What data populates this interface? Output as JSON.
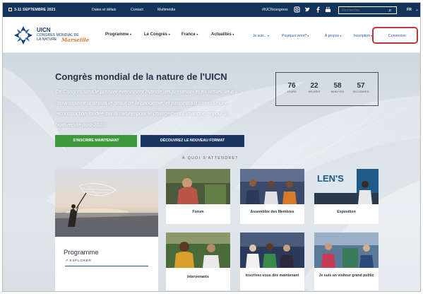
{
  "topbar": {
    "date": "3-11 SEPTEMBRE 2021",
    "links": [
      "Dates et délais",
      "Contact",
      "Multimédia"
    ],
    "hashtag": "#IUCNcongress",
    "social_icons": [
      "instagram-icon",
      "twitter-icon",
      "facebook-icon",
      "youtube-icon"
    ],
    "search_placeholder": "Recherche",
    "search_icon": "⌕",
    "language": "FR",
    "chevron": "⌄"
  },
  "logo": {
    "line1": "UICN",
    "line2": "CONGRÈS MONDIAL DE LA NATURE",
    "line3": "Marseille"
  },
  "nav": {
    "main": [
      {
        "label": "Programme",
        "caret": "▾"
      },
      {
        "label": "Le Congrès",
        "caret": "▾"
      },
      {
        "label": "France",
        "caret": "▾"
      },
      {
        "label": "Actualités",
        "caret": "▾"
      }
    ],
    "secondary": [
      {
        "label": "Je suis...",
        "caret": "▾"
      },
      {
        "label": "Pourquoi venir?",
        "caret": "▾"
      },
      {
        "label": "À propos",
        "caret": "▾"
      },
      {
        "label": "Inscription",
        "caret": "▾"
      }
    ],
    "connexion": "Connexion"
  },
  "hero": {
    "title": "Congrès mondial de la nature de l'UICN",
    "description": "Ce Congrès sera le premier événement hybride, en présentiel et en virtuel, lié à l'environnement depuis le début de la pandémie, et permettra d'agir pour une reconstruction fondée sur la nature, pour le changement climatique et pour la biodiversité post-2020.",
    "countdown": [
      {
        "value": "76",
        "label": "JOURS"
      },
      {
        "value": "22",
        "label": "HEURES"
      },
      {
        "value": "58",
        "label": "MINUTES"
      },
      {
        "value": "57",
        "label": "SECONDES"
      }
    ],
    "btn_register": "S'INSCRIRE MAINTENANT",
    "btn_discover": "DÉCOUVREZ LE NOUVEAU FORMAT",
    "section_label": "À QUOI S'ATTENDRE?"
  },
  "program_card": {
    "title": "Programme",
    "link": "↗ EXPLORER"
  },
  "cards": [
    {
      "label": "Forum"
    },
    {
      "label": "Assemblée des Membres"
    },
    {
      "label": "Exposition"
    },
    {
      "label": "Intervenants"
    },
    {
      "label": "Inscrivez-vous dès maintenant"
    },
    {
      "label": "Je suis un visiteur grand public"
    }
  ],
  "colors": {
    "topbar": "#14335b",
    "green_button": "#3d9a3b",
    "navy_button": "#1b3563",
    "link_blue": "#2d55a5",
    "highlight": "#b73a3a",
    "logo_orange": "#e17a2a"
  }
}
